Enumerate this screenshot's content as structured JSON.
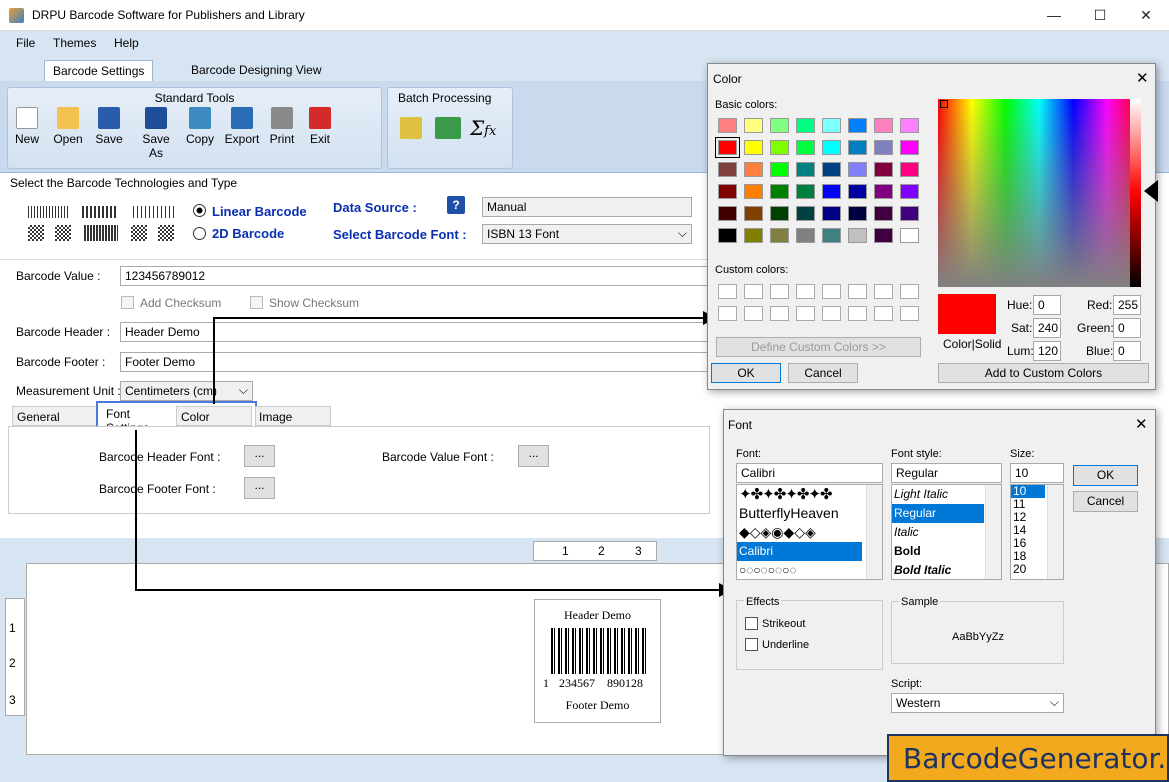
{
  "app": {
    "title": "DRPU Barcode Software for Publishers and Library",
    "minimize": "—",
    "maximize": "☐",
    "close": "✕"
  },
  "menu": [
    "File",
    "Themes",
    "Help"
  ],
  "tabs": [
    "Barcode Settings",
    "Barcode Designing View"
  ],
  "standard_tools": {
    "title": "Standard Tools",
    "items": [
      "New",
      "Open",
      "Save",
      "Save As",
      "Copy",
      "Export",
      "Print",
      "Exit"
    ]
  },
  "batch": {
    "title": "Batch Processing"
  },
  "tech": {
    "title": "Select the Barcode Technologies and Type",
    "linear": "Linear Barcode",
    "twod": "2D Barcode",
    "data_source_label": "Data Source :",
    "data_source_value": "Manual",
    "font_label": "Select Barcode Font :",
    "font_value": "ISBN 13 Font"
  },
  "form": {
    "value_label": "Barcode Value :",
    "value": "123456789012",
    "add_checksum": "Add Checksum",
    "show_checksum": "Show Checksum",
    "header_label": "Barcode Header :",
    "header": "Header Demo",
    "footer_label": "Barcode Footer :",
    "footer": "Footer Demo",
    "unit_label": "Measurement Unit :",
    "unit": "Centimeters (cm)"
  },
  "subtabs": [
    "General Settings",
    "Font Settings",
    "Color Settings",
    "Image Settings"
  ],
  "font_settings": {
    "header_font": "Barcode Header Font :",
    "footer_font": "Barcode Footer Font :",
    "value_font": "Barcode Value Font :",
    "ellipsis": "..."
  },
  "ruler": {
    "top": [
      "1",
      "2",
      "3"
    ],
    "left": [
      "1",
      "2",
      "3"
    ]
  },
  "preview": {
    "header": "Header Demo",
    "digits": [
      "1",
      "234567",
      "890128"
    ],
    "footer": "Footer Demo"
  },
  "color_dialog": {
    "title": "Color",
    "basic": "Basic colors:",
    "custom": "Custom colors:",
    "define": "Define Custom Colors >>",
    "ok": "OK",
    "cancel": "Cancel",
    "colorsolid": "Color|Solid",
    "hue_label": "Hue:",
    "hue": "0",
    "sat_label": "Sat:",
    "sat": "240",
    "lum_label": "Lum:",
    "lum": "120",
    "red_label": "Red:",
    "red": "255",
    "green_label": "Green:",
    "green": "0",
    "blue_label": "Blue:",
    "blue": "0",
    "add_custom": "Add to Custom Colors",
    "swatches": [
      "#ff8080",
      "#ffff80",
      "#80ff80",
      "#00ff80",
      "#80ffff",
      "#0080ff",
      "#ff80c0",
      "#ff80ff",
      "#ff0000",
      "#ffff00",
      "#80ff00",
      "#00ff40",
      "#00ffff",
      "#0080c0",
      "#8080c0",
      "#ff00ff",
      "#804040",
      "#ff8040",
      "#00ff00",
      "#008080",
      "#004080",
      "#8080ff",
      "#800040",
      "#ff0080",
      "#800000",
      "#ff8000",
      "#008000",
      "#008040",
      "#0000ff",
      "#0000a0",
      "#800080",
      "#8000ff",
      "#400000",
      "#804000",
      "#004000",
      "#004040",
      "#000080",
      "#000040",
      "#400040",
      "#400080",
      "#000000",
      "#808000",
      "#808040",
      "#808080",
      "#408080",
      "#c0c0c0",
      "#400040",
      "#ffffff"
    ]
  },
  "font_dialog": {
    "title": "Font",
    "font_label": "Font:",
    "font_value": "Calibri",
    "fonts": [
      "ButterflyHeaven",
      "Calibri"
    ],
    "style_label": "Font style:",
    "style_value": "Regular",
    "styles": [
      "Light Italic",
      "Regular",
      "Italic",
      "Bold",
      "Bold Italic"
    ],
    "size_label": "Size:",
    "size_value": "10",
    "sizes": [
      "10",
      "11",
      "12",
      "14",
      "16",
      "18",
      "20"
    ],
    "ok": "OK",
    "cancel": "Cancel",
    "effects": "Effects",
    "strikeout": "Strikeout",
    "underline": "Underline",
    "sample": "Sample",
    "sample_text": "AaBbYyZz",
    "script_label": "Script:",
    "script_value": "Western"
  },
  "watermark": "BarcodeGenerator.us"
}
